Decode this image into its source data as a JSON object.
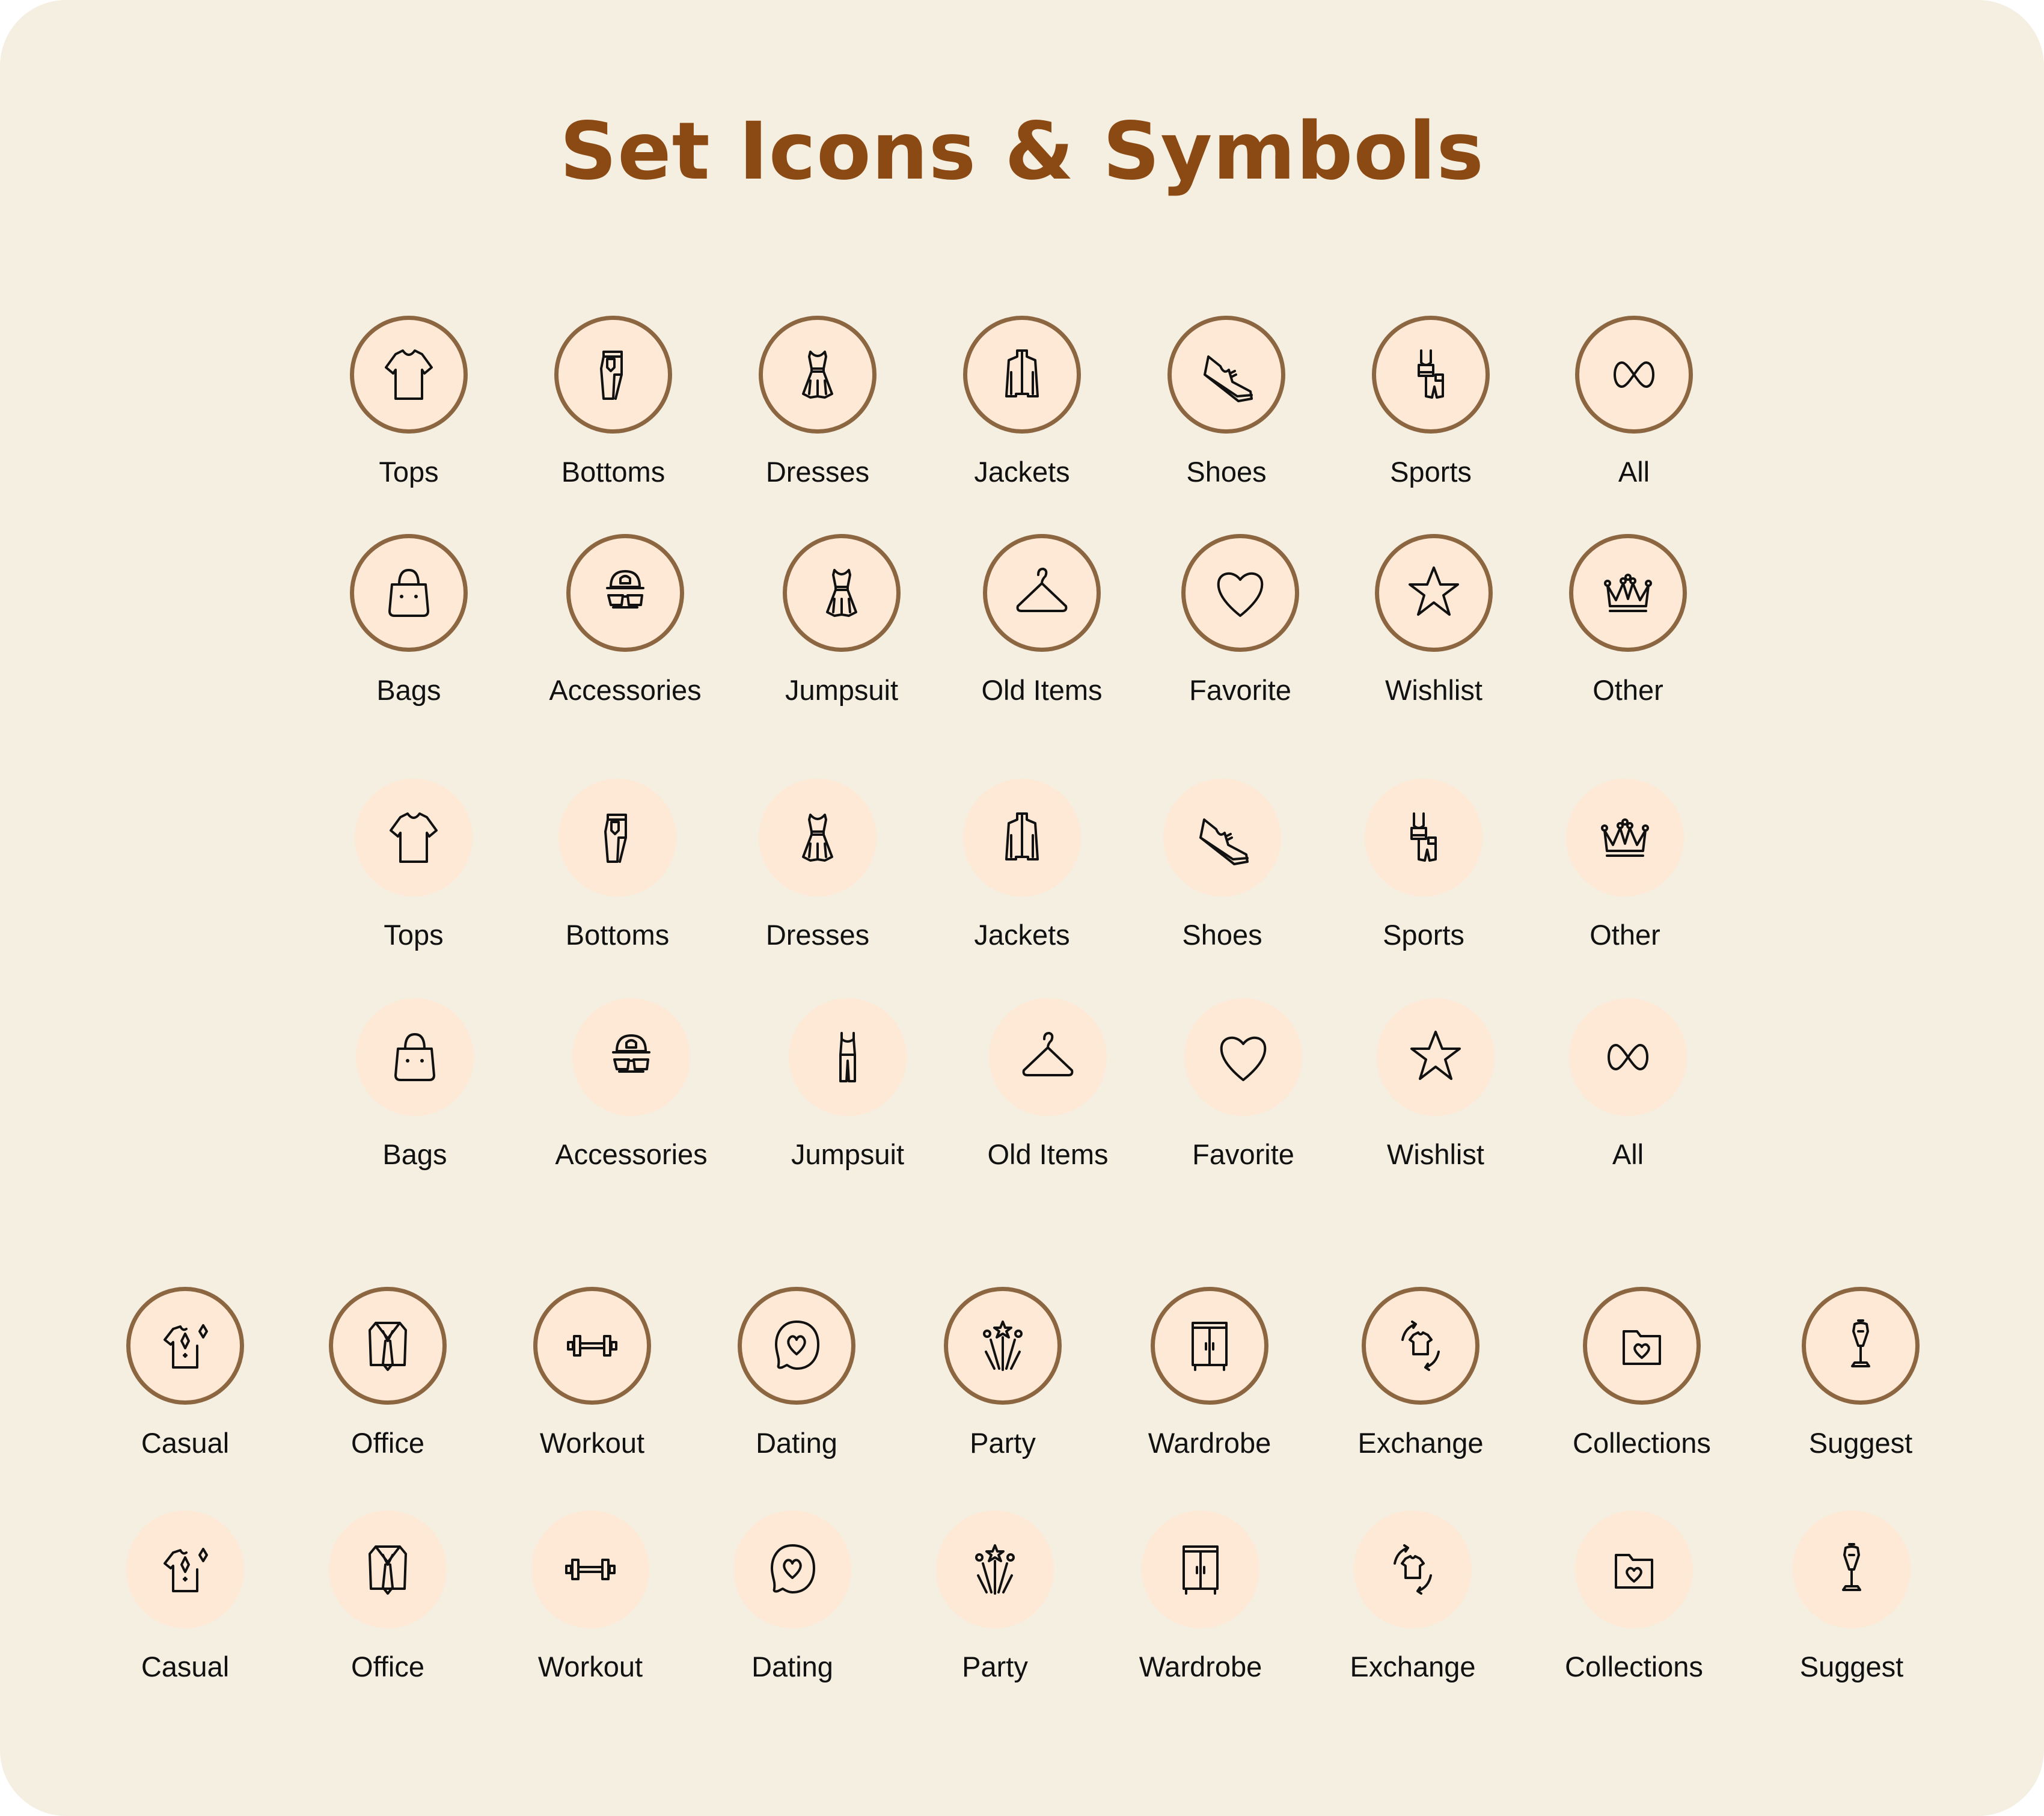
{
  "title": "Set Icons & Symbols",
  "colors": {
    "background": "#f5efe2",
    "title": "#8b4a14",
    "circle_fill": "#fde9d5",
    "circle_border": "#8b6641",
    "icon_stroke": "#111111"
  },
  "rows": [
    {
      "style": "outlined",
      "items": [
        {
          "label": "Tops",
          "icon": "tshirt-icon"
        },
        {
          "label": "Bottoms",
          "icon": "pants-icon"
        },
        {
          "label": "Dresses",
          "icon": "dress-icon"
        },
        {
          "label": "Jackets",
          "icon": "jacket-icon"
        },
        {
          "label": "Shoes",
          "icon": "sneaker-icon"
        },
        {
          "label": "Sports",
          "icon": "sportswear-icon"
        },
        {
          "label": "All",
          "icon": "infinity-icon"
        }
      ]
    },
    {
      "style": "outlined",
      "items": [
        {
          "label": "Bags",
          "icon": "bag-icon"
        },
        {
          "label": "Accessories",
          "icon": "cap-glasses-icon"
        },
        {
          "label": "Jumpsuit",
          "icon": "dress-icon"
        },
        {
          "label": "Old Items",
          "icon": "hanger-icon"
        },
        {
          "label": "Favorite",
          "icon": "heart-icon"
        },
        {
          "label": "Wishlist",
          "icon": "star-icon"
        },
        {
          "label": "Other",
          "icon": "crown-icon"
        }
      ]
    },
    {
      "style": "filled",
      "items": [
        {
          "label": "Tops",
          "icon": "tshirt-icon"
        },
        {
          "label": "Bottoms",
          "icon": "pants-icon"
        },
        {
          "label": "Dresses",
          "icon": "dress-icon"
        },
        {
          "label": "Jackets",
          "icon": "jacket-icon"
        },
        {
          "label": "Shoes",
          "icon": "sneaker-icon"
        },
        {
          "label": "Sports",
          "icon": "sportswear-icon"
        },
        {
          "label": "Other",
          "icon": "crown-icon"
        }
      ]
    },
    {
      "style": "filled",
      "items": [
        {
          "label": "Bags",
          "icon": "bag-icon"
        },
        {
          "label": "Accessories",
          "icon": "cap-glasses-icon"
        },
        {
          "label": "Jumpsuit",
          "icon": "jumpsuit-icon"
        },
        {
          "label": "Old Items",
          "icon": "hanger-icon"
        },
        {
          "label": "Favorite",
          "icon": "heart-icon"
        },
        {
          "label": "Wishlist",
          "icon": "star-icon"
        },
        {
          "label": "All",
          "icon": "infinity-icon"
        }
      ]
    },
    {
      "style": "outlined",
      "items": [
        {
          "label": "Casual",
          "icon": "casual-shirt-icon"
        },
        {
          "label": "Office",
          "icon": "suit-tie-icon"
        },
        {
          "label": "Workout",
          "icon": "dumbbell-icon"
        },
        {
          "label": "Dating",
          "icon": "chat-heart-icon"
        },
        {
          "label": "Party",
          "icon": "fireworks-icon"
        },
        {
          "label": "Wardrobe",
          "icon": "wardrobe-icon"
        },
        {
          "label": "Exchange",
          "icon": "exchange-icon"
        },
        {
          "label": "Collections",
          "icon": "folder-heart-icon"
        },
        {
          "label": "Suggest",
          "icon": "mannequin-icon"
        }
      ]
    },
    {
      "style": "filled",
      "items": [
        {
          "label": "Casual",
          "icon": "casual-shirt-icon"
        },
        {
          "label": "Office",
          "icon": "suit-tie-icon"
        },
        {
          "label": "Workout",
          "icon": "dumbbell-icon"
        },
        {
          "label": "Dating",
          "icon": "chat-heart-icon"
        },
        {
          "label": "Party",
          "icon": "fireworks-icon"
        },
        {
          "label": "Wardrobe",
          "icon": "wardrobe-icon"
        },
        {
          "label": "Exchange",
          "icon": "exchange-icon"
        },
        {
          "label": "Collections",
          "icon": "folder-heart-icon"
        },
        {
          "label": "Suggest",
          "icon": "mannequin-icon"
        }
      ]
    }
  ]
}
